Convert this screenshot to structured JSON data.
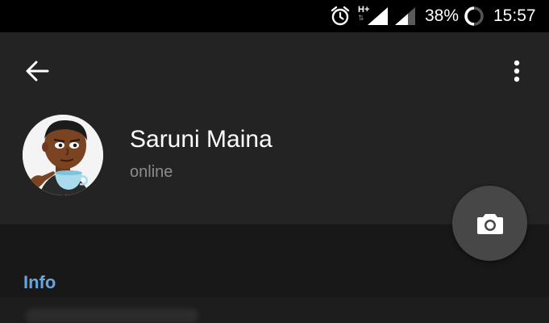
{
  "status_bar": {
    "network_type": "H+",
    "battery_percent": "38%",
    "time": "15:57",
    "icons": [
      "alarm-icon",
      "mobile-signal-icon",
      "wifi-signal-icon",
      "battery-ring-icon"
    ]
  },
  "header": {
    "back_icon": "arrow-left-icon",
    "menu_icon": "more-vertical-icon"
  },
  "profile": {
    "name": "Saruni Maina",
    "status": "online",
    "avatar_icon": "cartoon-avatar"
  },
  "fab": {
    "icon": "camera-icon"
  },
  "info": {
    "heading": "Info"
  },
  "colors": {
    "status_bar_bg": "#000000",
    "header_bg": "#232323",
    "page_bg": "#181818",
    "accent": "#68a5e0",
    "fab_bg": "#474747",
    "muted_text": "#8c8c8c"
  }
}
